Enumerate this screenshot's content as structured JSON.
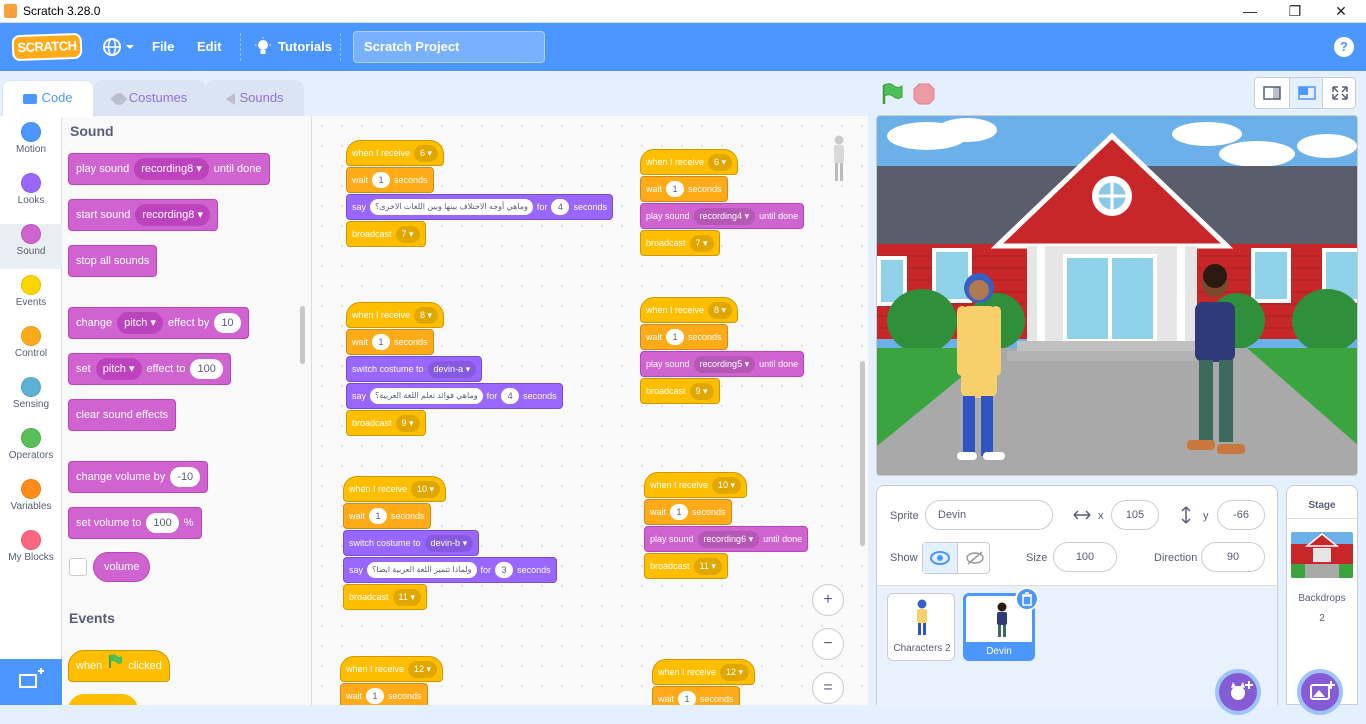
{
  "window": {
    "title": "Scratch 3.28.0",
    "min": "—",
    "max": "❐",
    "close": "✕"
  },
  "menu": {
    "logo": "SCRATCH",
    "file": "File",
    "edit": "Edit",
    "tutorials": "Tutorials",
    "project_title": "Scratch Project",
    "help": "?"
  },
  "tabs": {
    "code": "Code",
    "costumes": "Costumes",
    "sounds": "Sounds"
  },
  "categories": [
    {
      "label": "Motion",
      "color": "#4c97ff"
    },
    {
      "label": "Looks",
      "color": "#9966ff"
    },
    {
      "label": "Sound",
      "color": "#cf63cf"
    },
    {
      "label": "Events",
      "color": "#ffd500"
    },
    {
      "label": "Control",
      "color": "#ffab19"
    },
    {
      "label": "Sensing",
      "color": "#5cb1d6"
    },
    {
      "label": "Operators",
      "color": "#59c059"
    },
    {
      "label": "Variables",
      "color": "#ff8c1a"
    },
    {
      "label": "My Blocks",
      "color": "#ff6680"
    }
  ],
  "palette": {
    "sound_heading": "Sound",
    "play_sound": "play sound",
    "until_done": "until done",
    "rec8": "recording8",
    "start_sound": "start sound",
    "stop_all": "stop all sounds",
    "change": "change",
    "pitch": "pitch",
    "effect_by": "effect by",
    "ten": "10",
    "set": "set",
    "effect_to": "effect to",
    "hundred": "100",
    "clear_effects": "clear sound effects",
    "change_volume_by": "change volume by",
    "minus10": "-10",
    "set_volume_to": "set volume to",
    "percent": "%",
    "volume": "volume",
    "events_heading": "Events",
    "when": "when",
    "clicked": "clicked"
  },
  "scripts": {
    "when_i_receive": "when I receive",
    "wait": "wait",
    "seconds": "seconds",
    "say": "say",
    "for": "for",
    "broadcast": "broadcast",
    "switch_costume_to": "switch costume to",
    "play_sound": "play sound",
    "until_done": "until done",
    "one": "1",
    "four": "4",
    "three": "3",
    "m6": "6",
    "m7": "7",
    "m8": "8",
    "m9": "9",
    "m10": "10",
    "m11": "11",
    "m12": "12",
    "rec4": "recording4",
    "rec5": "recording5",
    "rec6": "recording6",
    "devin_a": "devin-a",
    "devin_b": "devin-b",
    "say1": "وماهي أوجه الاختلاف بينها وبين اللغات الاخرى؟",
    "say2": "وماهي فوائد تعلم اللغة العربية؟",
    "say3": "ولماذا تتميز اللغة العربية ايضا؟"
  },
  "zoom": {
    "in": "+",
    "out": "−",
    "reset": "="
  },
  "sprite_info": {
    "sprite_label": "Sprite",
    "sprite_name": "Devin",
    "x_label": "x",
    "x": "105",
    "y_label": "y",
    "y": "-66",
    "show_label": "Show",
    "size_label": "Size",
    "size": "100",
    "direction_label": "Direction",
    "direction": "90"
  },
  "sprites": [
    {
      "name": "Characters 2"
    },
    {
      "name": "Devin"
    }
  ],
  "stage_panel": {
    "title": "Stage",
    "backdrops_label": "Backdrops",
    "backdrops_count": "2"
  }
}
